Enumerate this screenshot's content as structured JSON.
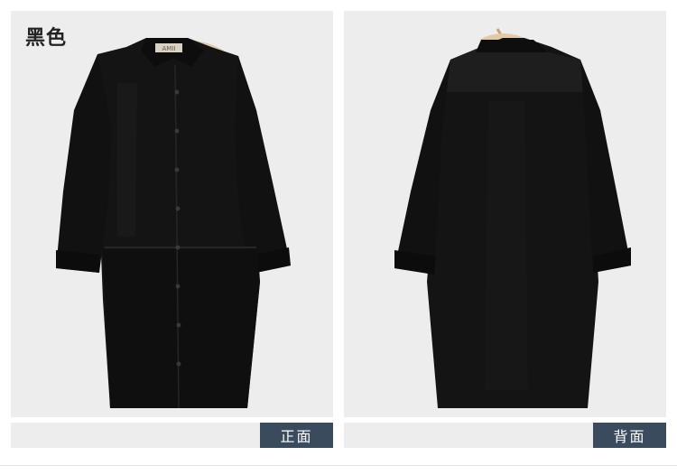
{
  "color_label": "黑色",
  "hanger_brand": "AMII",
  "front_tag": "正面",
  "back_tag": "背面",
  "colors": {
    "panel_bg": "#ededed",
    "garment": "#131313",
    "tag_bg": "#3a4b5d",
    "hanger": "#e3c9a6"
  }
}
